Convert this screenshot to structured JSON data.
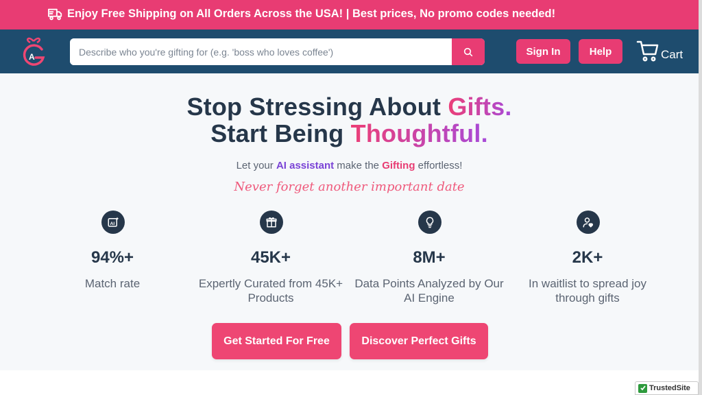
{
  "promo": {
    "text": "Enjoy Free Shipping on All Orders Across the USA! | Best prices, No promo codes needed!",
    "icon": "truck-icon"
  },
  "header": {
    "logo": "gift-logo-icon",
    "search": {
      "placeholder": "Describe who you're gifting for (e.g. 'boss who loves coffee')",
      "value": ""
    },
    "sign_in_label": "Sign In",
    "help_label": "Help",
    "cart_label": "Cart"
  },
  "hero": {
    "line1_prefix": "Stop Stressing About ",
    "line1_accent": "Gifts.",
    "line2_prefix": "Start Being ",
    "line2_accent": "Thoughtful.",
    "sub_prefix": "Let your ",
    "sub_ai": "AI assistant",
    "sub_mid": " make the ",
    "sub_gifting": "Gifting",
    "sub_suffix": " effortless!",
    "script": "Never forget another important date"
  },
  "stats": [
    {
      "icon": "ai-icon",
      "value": "94%+",
      "label": "Match rate"
    },
    {
      "icon": "gift-icon",
      "value": "45K+",
      "label": "Expertly Curated from 45K+ Products"
    },
    {
      "icon": "lightbulb-icon",
      "value": "8M+",
      "label": "Data Points Analyzed by Our AI Engine"
    },
    {
      "icon": "user-heart-icon",
      "value": "2K+",
      "label": "In waitlist to spread joy through gifts"
    }
  ],
  "cta": {
    "primary": "Get Started For Free",
    "secondary": "Discover Perfect Gifts"
  },
  "badge": {
    "text": "TrustedSite"
  },
  "colors": {
    "brand_pink": "#e83c73",
    "header_navy": "#1e4c6e",
    "heading": "#26374a",
    "accent_purple": "#7a43d6"
  }
}
